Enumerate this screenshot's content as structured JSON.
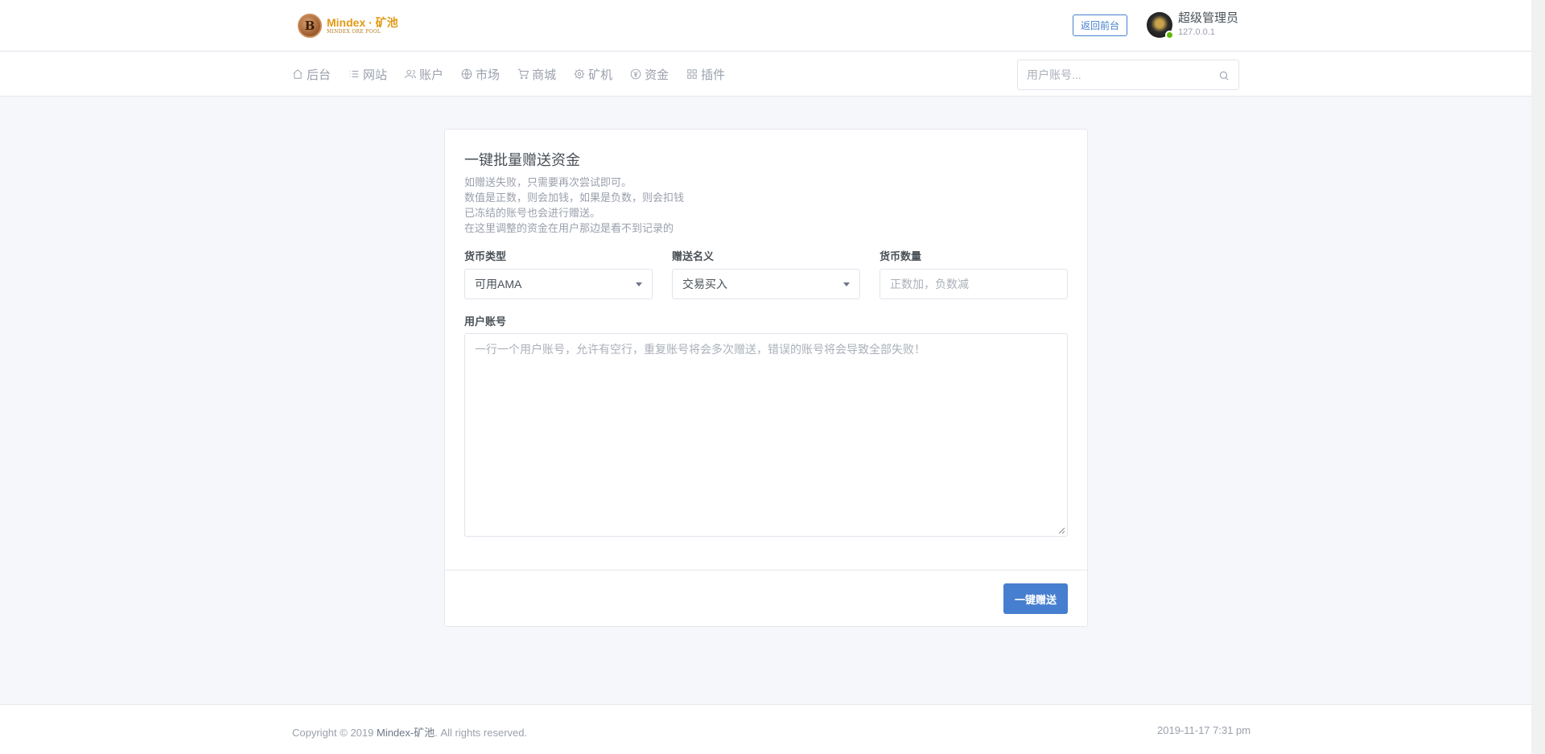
{
  "header": {
    "logo_text": "Mindex · 矿池",
    "logo_sub": "MINDEX ORE POOL",
    "logo_letter": "B",
    "front_button": "返回前台",
    "user_name": "超级管理员",
    "user_ip": "127.0.0.1"
  },
  "nav": {
    "items": [
      {
        "label": "后台",
        "icon": "home-icon"
      },
      {
        "label": "网站",
        "icon": "list-icon"
      },
      {
        "label": "账户",
        "icon": "users-icon"
      },
      {
        "label": "市场",
        "icon": "globe-icon"
      },
      {
        "label": "商城",
        "icon": "cart-icon"
      },
      {
        "label": "矿机",
        "icon": "cpu-icon"
      },
      {
        "label": "资金",
        "icon": "money-icon"
      },
      {
        "label": "插件",
        "icon": "grid-icon"
      }
    ],
    "search_placeholder": "用户账号..."
  },
  "form": {
    "title": "一键批量赠送资金",
    "notes": [
      "如赠送失败，只需要再次尝试即可。",
      "数值是正数，则会加钱，如果是负数，则会扣钱",
      "已冻结的账号也会进行赠送。",
      "在这里调整的资金在用户那边是看不到记录的"
    ],
    "currency_label": "货币类型",
    "currency_value": "可用AMA",
    "reason_label": "赠送名义",
    "reason_value": "交易买入",
    "amount_label": "货币数量",
    "amount_placeholder": "正数加，负数减",
    "accounts_label": "用户账号",
    "accounts_placeholder": "一行一个用户账号，允许有空行，重复账号将会多次赠送，错误的账号将会导致全部失败！",
    "submit_label": "一键赠送"
  },
  "footer": {
    "copyright_prefix": "Copyright © 2019 ",
    "copyright_brand": "Mindex-矿池",
    "copyright_suffix": ". All rights reserved.",
    "timestamp": "2019-11-17 7:31 pm"
  },
  "colors": {
    "primary": "#467fcf",
    "online": "#5eba00",
    "logo": "#e19a14"
  }
}
